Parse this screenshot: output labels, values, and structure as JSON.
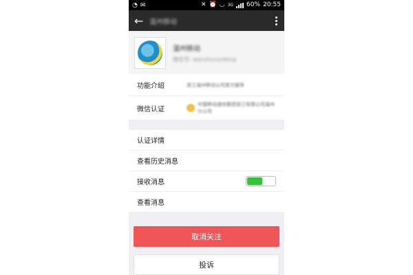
{
  "status_bar": {
    "network_label": "3G",
    "battery": "60%",
    "time": "20:55"
  },
  "title_bar": {
    "title": "温州移动"
  },
  "profile": {
    "name": "温州移动",
    "account_id": "微信号: wenzhouyidong"
  },
  "info": {
    "intro_label": "功能介绍",
    "intro_value": "浙江温州移动公司官方服务",
    "cert_label": "微信认证",
    "cert_value": "中国移动通信集团浙江有限公司温州分公司"
  },
  "menu": {
    "items": [
      {
        "label": "认证详情"
      },
      {
        "label": "查看历史消息"
      },
      {
        "label": "接收消息"
      },
      {
        "label": "查看消息"
      }
    ],
    "receive_messages_on": true
  },
  "buttons": {
    "unfollow": "取消关注",
    "report": "投诉"
  },
  "colors": {
    "title_bar": "#2b2b2b",
    "unfollow": "#f05658",
    "toggle_on": "#35c23d"
  }
}
